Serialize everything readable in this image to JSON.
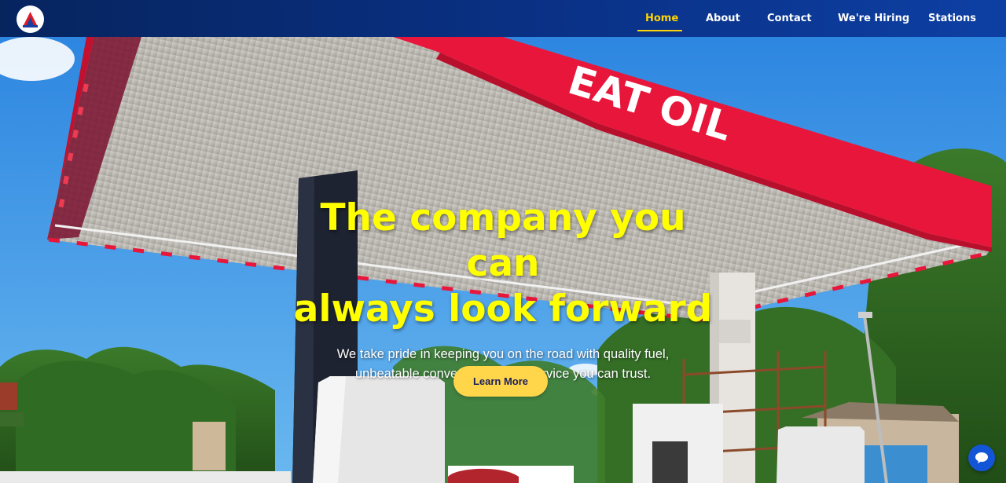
{
  "nav": {
    "logo_icon": "company-logo-icon",
    "items": [
      {
        "label": "Home",
        "active": true
      },
      {
        "label": "About",
        "active": false
      },
      {
        "label": "Contact",
        "active": false
      },
      {
        "label": "We're Hiring",
        "active": false
      },
      {
        "label": "Stations",
        "active": false
      }
    ]
  },
  "hero": {
    "headline_lines": [
      "The company you",
      "can",
      "always look forward"
    ],
    "subtitle_lines": [
      "We take pride in keeping you on the road with quality fuel,",
      "unbeatable convenience, and service you can trust."
    ],
    "cta_label": "Learn More",
    "canopy_sign_text": "EAT OIL",
    "background_description_icon": "gas-station-canopy-photo"
  },
  "chat": {
    "icon": "chat-bubble-icon"
  },
  "colors": {
    "nav_bg": "#0a3186",
    "accent_yellow": "#ffff00",
    "active_nav": "#ffd400",
    "button_bg": "#ffd54a",
    "sign_red": "#e8163a",
    "sky_blue": "#4aa3e8"
  }
}
